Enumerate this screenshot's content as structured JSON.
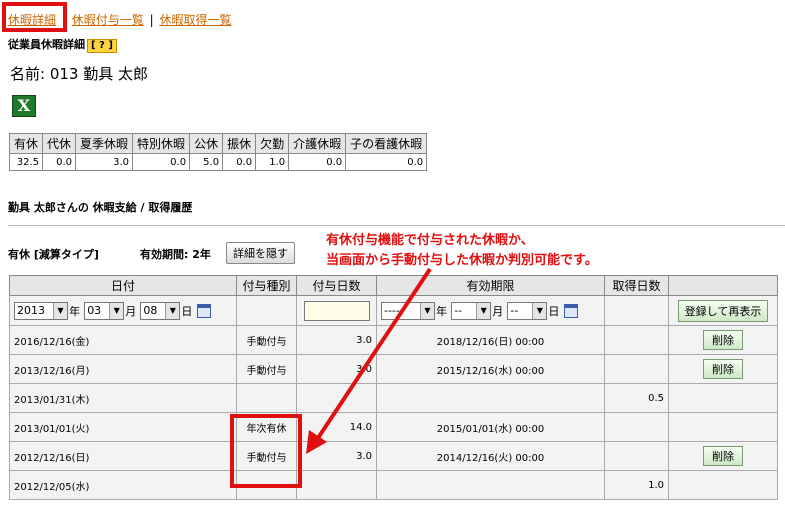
{
  "nav": {
    "link1": "休暇詳細",
    "sep1": "|",
    "link2": "休暇付与一覧",
    "sep2": "|",
    "link3": "休暇取得一覧"
  },
  "section_title": "従業員休暇詳細",
  "help_label": "[ ? ]",
  "employee_name": "名前: 013 勤具 太郎",
  "excel_icon": "excel-export-icon",
  "summary": {
    "headers": [
      "有休",
      "代休",
      "夏季休暇",
      "特別休暇",
      "公休",
      "振休",
      "欠勤",
      "介護休暇",
      "子の看護休暇"
    ],
    "values": [
      "32.5",
      "0.0",
      "3.0",
      "0.0",
      "5.0",
      "0.0",
      "1.0",
      "0.0",
      "0.0"
    ]
  },
  "history_title": "勤具 太郎さんの 休暇支給 / 取得履歴",
  "leave_type": "有休 [減算タイプ]",
  "validity": "有効期間: 2年",
  "detail_hide_button": "詳細を隠す",
  "annotation": {
    "line1": "有休付与機能で付与された休暇か、",
    "line2": "当画面から手動付与した休暇か判別可能です。"
  },
  "history": {
    "headers": [
      "日付",
      "付与種別",
      "付与日数",
      "有効期限",
      "取得日数",
      ""
    ],
    "input": {
      "year": "2013",
      "year_unit": "年",
      "month": "03",
      "month_unit": "月",
      "day": "08",
      "day_unit": "日",
      "exp_year": "----",
      "exp_year_unit": "年",
      "exp_month": "--",
      "exp_month_unit": "月",
      "exp_day": "--",
      "exp_day_unit": "日",
      "register_button": "登録して再表示"
    },
    "rows": [
      {
        "date": "2016/12/16(金)",
        "type": "手動付与",
        "granted": "3.0",
        "expiry": "2018/12/16(日) 00:00",
        "taken": "",
        "action": "削除"
      },
      {
        "date": "2013/12/16(月)",
        "type": "手動付与",
        "granted": "3.0",
        "expiry": "2015/12/16(水) 00:00",
        "taken": "",
        "action": "削除"
      },
      {
        "date": "2013/01/31(木)",
        "type": "",
        "granted": "",
        "expiry": "",
        "taken": "0.5",
        "action": ""
      },
      {
        "date": "2013/01/01(火)",
        "type": "年次有休",
        "granted": "14.0",
        "expiry": "2015/01/01(水) 00:00",
        "taken": "",
        "action": ""
      },
      {
        "date": "2012/12/16(日)",
        "type": "手動付与",
        "granted": "3.0",
        "expiry": "2014/12/16(火) 00:00",
        "taken": "",
        "action": "削除"
      },
      {
        "date": "2012/12/05(水)",
        "type": "",
        "granted": "",
        "expiry": "",
        "taken": "1.0",
        "action": ""
      }
    ]
  },
  "colors": {
    "link": "#cc6600",
    "highlight_red": "#e01010",
    "header_bg": "#e6e6e6",
    "excel_green": "#1f7a2b"
  }
}
